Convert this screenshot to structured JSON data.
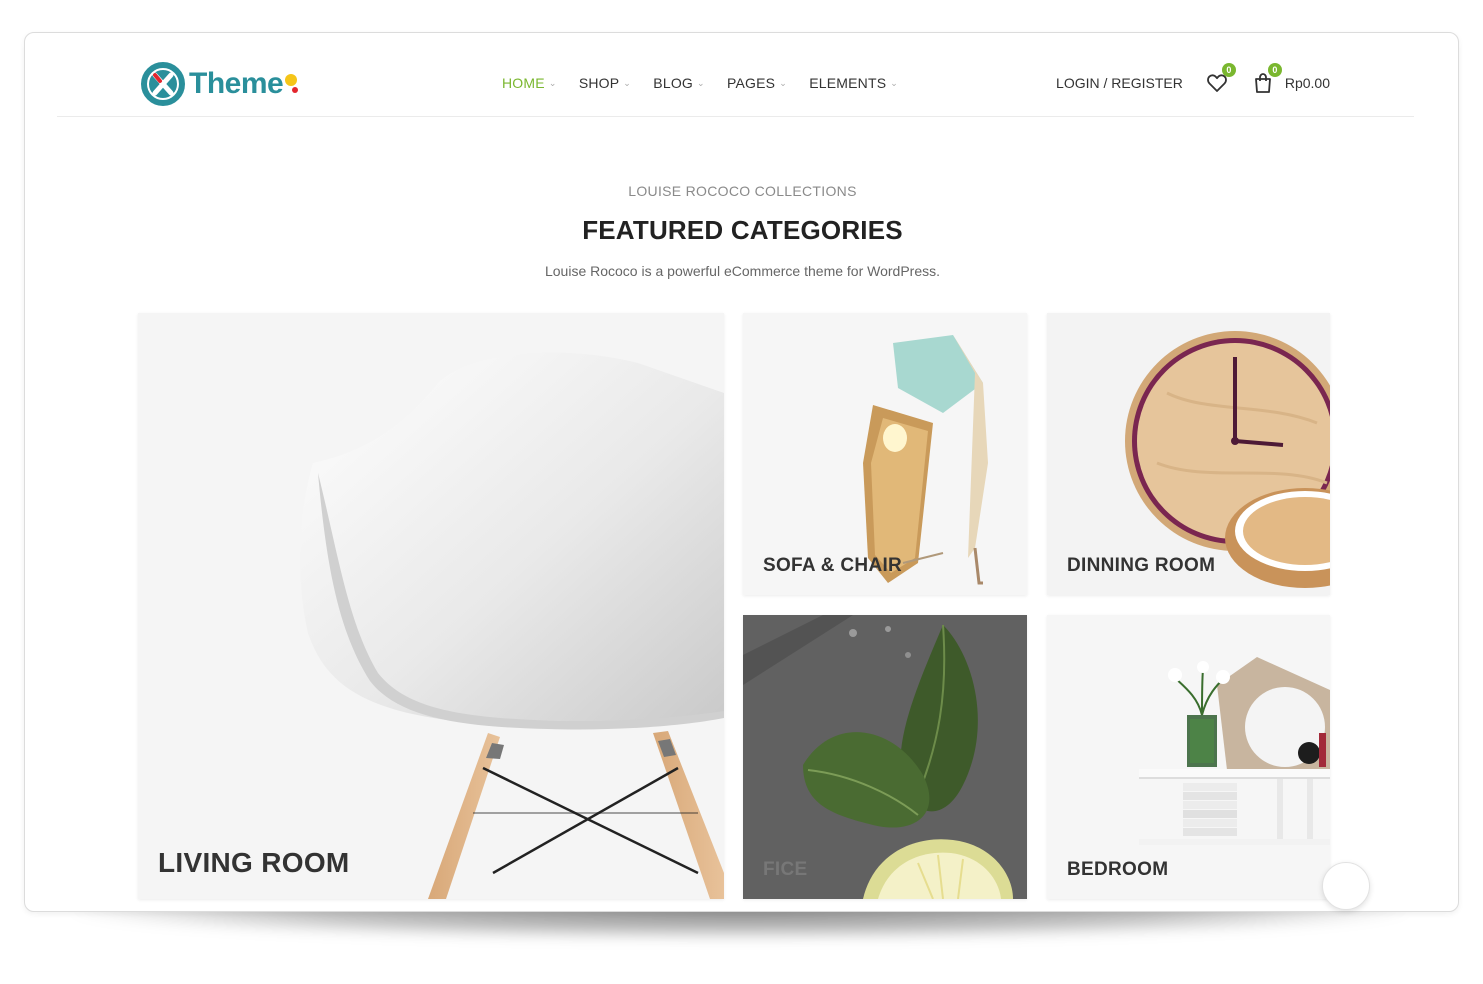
{
  "header": {
    "logo_text": "Theme",
    "nav": [
      {
        "label": "HOME",
        "active": true
      },
      {
        "label": "SHOP",
        "active": false
      },
      {
        "label": "BLOG",
        "active": false
      },
      {
        "label": "PAGES",
        "active": false
      },
      {
        "label": "ELEMENTS",
        "active": false
      }
    ],
    "login_label": "LOGIN / REGISTER",
    "wishlist_count": "0",
    "cart_count": "0",
    "cart_total": "Rp0.00",
    "icons": [
      "logo-x-icon",
      "heart-icon",
      "shopping-bag-icon",
      "chevron-down-icon"
    ]
  },
  "section": {
    "subtitle": "LOUISE ROCOCO COLLECTIONS",
    "title": "FEATURED CATEGORIES",
    "description": "Louise Rococo is a powerful eCommerce theme for WordPress."
  },
  "categories": [
    {
      "label": "LIVING ROOM",
      "image": "white-chair"
    },
    {
      "label": "SOFA & CHAIR",
      "image": "table-lamp"
    },
    {
      "label": "DINNING ROOM",
      "image": "wood-clock"
    },
    {
      "label": "FICE",
      "image": "leaf-lemon"
    },
    {
      "label": "BEDROOM",
      "image": "shelf-vase"
    }
  ],
  "colors": {
    "accent": "#7ab72f",
    "brand": "#2a8f9b",
    "text": "#333333"
  }
}
